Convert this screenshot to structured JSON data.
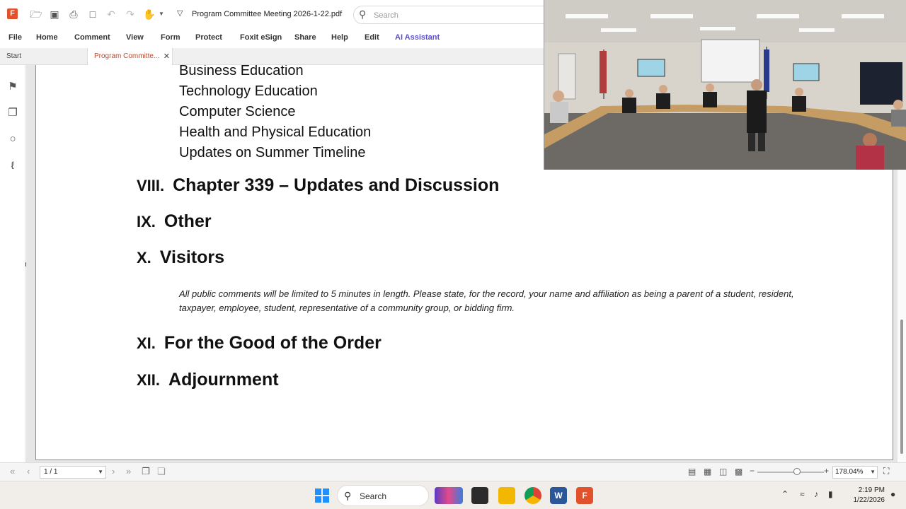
{
  "app": {
    "document_title": "Program Committee Meeting 2026-1-22.pdf",
    "search_placeholder": "Search"
  },
  "menu": [
    "File",
    "Home",
    "Comment",
    "View",
    "Form",
    "Protect",
    "Foxit eSign",
    "Share",
    "Help",
    "Edit",
    "AI Assistant"
  ],
  "tabs": {
    "start": "Start",
    "active": "Program Committe..."
  },
  "document": {
    "sub_items": [
      "Business Education",
      "Technology Education",
      "Computer Science",
      "Health and Physical Education",
      "Updates on Summer Timeline"
    ],
    "sections": [
      {
        "num": "VIII.",
        "title": "Chapter 339 – Updates and Discussion"
      },
      {
        "num": "IX.",
        "title": "Other"
      },
      {
        "num": "X.",
        "title": "Visitors"
      },
      {
        "num": "XI.",
        "title": "For the Good of the Order"
      },
      {
        "num": "XII.",
        "title": "Adjournment"
      }
    ],
    "visitors_note": "All public comments will be limited to 5 minutes in length. Please state, for the record, your name and affiliation as being a parent of a student, resident, taxpayer, employee, student, representative of a community group, or bidding firm."
  },
  "status": {
    "page_indicator": "1 / 1",
    "zoom": "178.04%"
  },
  "taskbar": {
    "search_label": "Search",
    "time": "2:19 PM",
    "date": "1/22/2026"
  },
  "icons": {
    "bookmark": "bookmark-icon",
    "pages": "pages-icon",
    "comments": "comment-icon",
    "attachment": "paperclip-icon"
  }
}
